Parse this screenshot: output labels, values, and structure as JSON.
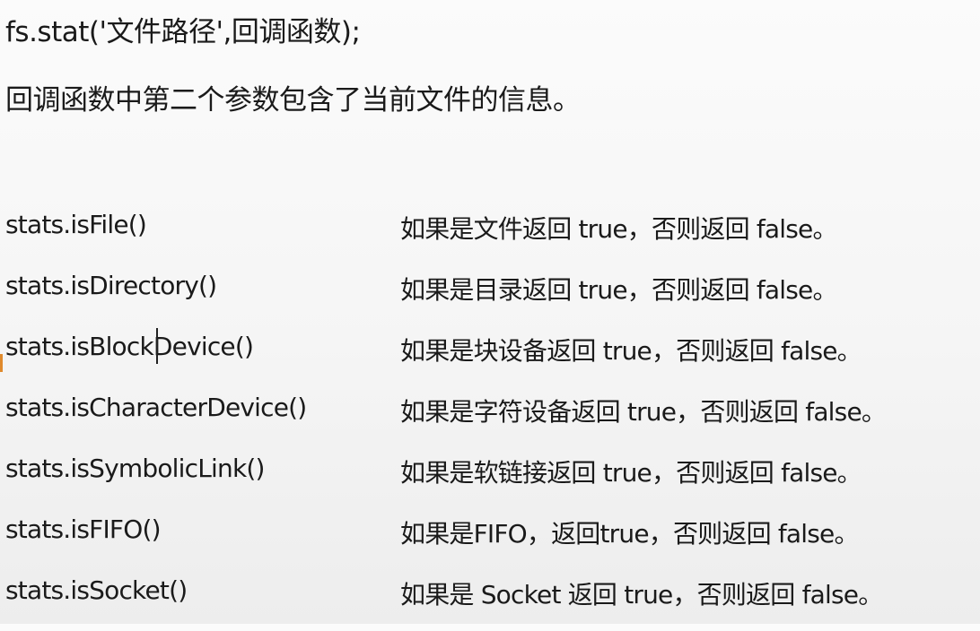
{
  "slide": {
    "signature": "fs.stat('文件路径',回调函数);",
    "description": "回调函数中第二个参数包含了当前文件的信息。",
    "methods": [
      {
        "name": "stats.isFile()",
        "desc": "如果是文件返回 true，否则返回 false。"
      },
      {
        "name": "stats.isDirectory()",
        "desc": "如果是目录返回 true，否则返回 false。"
      },
      {
        "name": "stats.isBlockDevice()",
        "desc": "如果是块设备返回 true，否则返回 false。"
      },
      {
        "name": "stats.isCharacterDevice()",
        "desc": "如果是字符设备返回 true，否则返回 false。"
      },
      {
        "name": "stats.isSymbolicLink()",
        "desc": "如果是软链接返回 true，否则返回 false。"
      },
      {
        "name": "stats.isFIFO()",
        "desc": "如果是FIFO，返回true，否则返回 false。"
      },
      {
        "name": "stats.isSocket()",
        "desc": "如果是 Socket 返回 true，否则返回 false。"
      }
    ]
  }
}
